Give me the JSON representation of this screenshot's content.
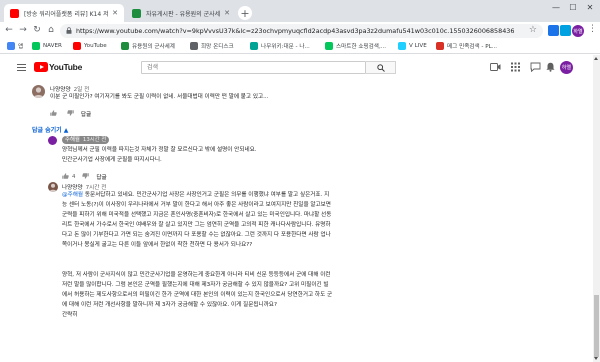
{
  "browser": {
    "tabs": [
      {
        "title": "[방송 워리어플랫폼 리뷰] K14 저",
        "favicon_color": "#ff0000"
      },
      {
        "title": "자유게시판 - 유용원의 군사세계",
        "favicon_color": "#1e8e3e"
      }
    ],
    "new_tab": "+",
    "controls": {
      "minimize": "—",
      "maximize": "☐",
      "close": "✕"
    },
    "nav": {
      "back": "←",
      "forward": "→",
      "reload": "↻",
      "home": "⌂"
    },
    "url": "https://www.youtube.com/watch?v=9kpVvvsU37k&lc=z23ochvpmyuqcfld2acdp43asvd3pa3z2dumafu541w03c010c.1550326006858436",
    "bookmark_star": "☆",
    "extensions": [
      {
        "name": "extension-1",
        "color": "#1a73e8"
      },
      {
        "name": "extension-2",
        "color": "#00a1e0"
      },
      {
        "name": "extension-3",
        "color": "#34a853"
      }
    ],
    "account_initial": "하엘",
    "menu": "⋮"
  },
  "bookmarks": [
    {
      "label": "앱",
      "color": "#4285f4"
    },
    {
      "label": "NAVER",
      "color": "#03c75a"
    },
    {
      "label": "YouTube",
      "color": "#ff0000"
    },
    {
      "label": "유용원의 군사세계",
      "color": "#1e8e3e"
    },
    {
      "label": "희망 온디스크",
      "color": "#5f6368"
    },
    {
      "label": "나무위키:대문 - 나...",
      "color": "#00a495"
    },
    {
      "label": "스마트한 쇼핑검색,...",
      "color": "#03c75a"
    },
    {
      "label": "V LIVE",
      "color": "#1ecfff"
    },
    {
      "label": "메그 민족검색 - PL...",
      "color": "#d93025"
    }
  ],
  "youtube": {
    "logo_text": "YouTube",
    "search_placeholder": "검색",
    "avatar_initial": "하엘"
  },
  "comments": [
    {
      "author": "나양양양",
      "time": "2일 전",
      "lines": [
        "이분 군 미필인가? 여기저기를 봐도 군필 이력이 없네. 서울대법대 이력만 떤 말에 붙고 있고..."
      ],
      "likes": "",
      "reply_label": "답글",
      "avatar_color": "#8d6e63"
    }
  ],
  "hide_replies_label": "답글 숨기기 ▲",
  "replies": [
    {
      "author": "주해월",
      "time": "13시간 전",
      "is_owner": true,
      "lines": [
        "양혁님께서 군필 이력을 따지는것 자체가 정말 잘 묘르신다고 밖에 설명이 안되네요.",
        "민간군사기업 사장에게 군필을 따지시다니."
      ],
      "likes": "4",
      "reply_label": "답글",
      "avatar_color": "#7b1fa2"
    },
    {
      "author": "나양양양",
      "time": "7시간 전",
      "mention": "@주해월",
      "lines": [
        " 동문서답하고 있네요. 민간군사기업 사장은 사장인거고 군필은 의무를 이행했냐 여부를 말고 싶은거죠. 지",
        "능 센터 노동(?)이 이사장이 우리나라에서 거부 말이 한다고 해서 아주 좋은 사람이라고 보여지지만 친일을 알고보면",
        "군력을 피하기 위해 미국적을 선택했고 지금은 혼인사명(중혼비자)로 한국에서 살고 있는 미국인입니다. 마냐할 선동",
        "리트 한국에서 가수로서 한국인 여배우와 잘 살고 있지만 그는 엄연히 군역을 고의적 피한 캐나다사람입니다. 유명하",
        "다고 돈 많이 기부한다고 가면 되는 숨겨진 이면까지 다 포용할 수는 없잖아요. 그런 것까지 다 포용한다면 사람 업나",
        "쪽이거나 몽실게 굴고는 다른 이들 앞에서 한없이 착한 천하면 다 용서가 되나요??",
        "",
        "",
        "양혁, 저 사람이 군사지식이 많고 민간군사기업을 운영하는게 중요한게 아니라 티비 신문 등등등에서 군에 대해 이런",
        "저런 말을 많이합니다. 그럼 본인은 군역을 필했는지에 대해 제3자가 궁금해할 수 있지 않을까요? 고위 미필이긴 빌",
        "에서 허용하는 제도사항으로서의 미필이긴 한가 군역에 대한 본인의 이력이 있는지 한국인으로서 당연한거고 하도 군",
        "에 대해 이런 저런 개선사항을 말하니까 제 3자가 궁금해할 수 있잖아요. 이게 질문됩니까요?",
        "간략히"
      ],
      "likes": "",
      "reply_label": "답글",
      "avatar_color": "#795548"
    }
  ]
}
